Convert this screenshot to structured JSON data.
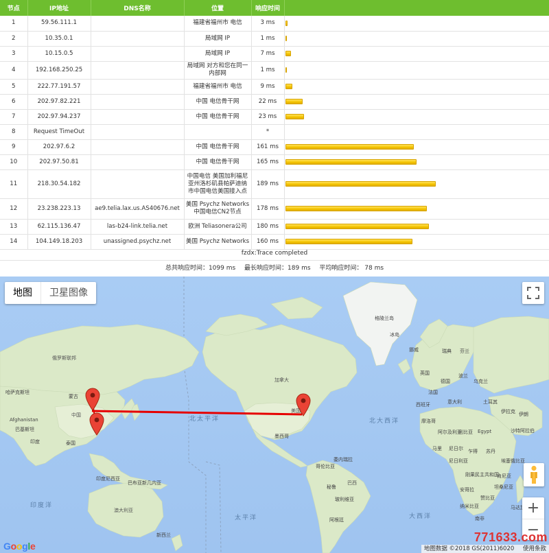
{
  "table": {
    "headers": [
      "节点",
      "IP地址",
      "DNS名称",
      "位置",
      "响应时间",
      ""
    ],
    "rows": [
      {
        "hop": "1",
        "ip": "59.56.111.1",
        "dns": "",
        "loc": "福建省福州市 电信",
        "time": "3 ms",
        "ms": 3
      },
      {
        "hop": "2",
        "ip": "10.35.0.1",
        "dns": "",
        "loc": "局域网 IP",
        "time": "1 ms",
        "ms": 1
      },
      {
        "hop": "3",
        "ip": "10.15.0.5",
        "dns": "",
        "loc": "局域网 IP",
        "time": "7 ms",
        "ms": 7
      },
      {
        "hop": "4",
        "ip": "192.168.250.25",
        "dns": "",
        "loc": "局域网 对方和您在同一内部网",
        "time": "1 ms",
        "ms": 1
      },
      {
        "hop": "5",
        "ip": "222.77.191.57",
        "dns": "",
        "loc": "福建省福州市 电信",
        "time": "9 ms",
        "ms": 9
      },
      {
        "hop": "6",
        "ip": "202.97.82.221",
        "dns": "",
        "loc": "中国 电信骨干网",
        "time": "22 ms",
        "ms": 22
      },
      {
        "hop": "7",
        "ip": "202.97.94.237",
        "dns": "",
        "loc": "中国 电信骨干网",
        "time": "23 ms",
        "ms": 23
      },
      {
        "hop": "8",
        "ip": "Request TimeOut",
        "dns": "",
        "loc": "",
        "time": "*",
        "ms": 0
      },
      {
        "hop": "9",
        "ip": "202.97.6.2",
        "dns": "",
        "loc": "中国 电信骨干网",
        "time": "161 ms",
        "ms": 161
      },
      {
        "hop": "10",
        "ip": "202.97.50.81",
        "dns": "",
        "loc": "中国 电信骨干网",
        "time": "165 ms",
        "ms": 165
      },
      {
        "hop": "11",
        "ip": "218.30.54.182",
        "dns": "",
        "loc": "中国电信 美国加利福尼亚州洛杉矶县帕萨迪纳市中国电信美国接入点",
        "time": "189 ms",
        "ms": 189
      },
      {
        "hop": "12",
        "ip": "23.238.223.13",
        "dns": "ae9.telia.lax.us.AS40676.net",
        "loc": "美国 Psychz Networks中国电信CN2节点",
        "time": "178 ms",
        "ms": 178
      },
      {
        "hop": "13",
        "ip": "62.115.136.47",
        "dns": "las-b24-link.telia.net",
        "loc": "欧洲 Teliasonera公司",
        "time": "180 ms",
        "ms": 180
      },
      {
        "hop": "14",
        "ip": "104.149.18.203",
        "dns": "unassigned.psychz.net",
        "loc": "美国 Psychz Networks",
        "time": "160 ms",
        "ms": 160
      }
    ],
    "bar_max_ms": 189
  },
  "trace": {
    "completed": "fzdx:Trace completed",
    "total": "总共响应时间：1099 ms",
    "max": "最长响应时间：189 ms",
    "avg": "平均响应时间： 78 ms"
  },
  "map": {
    "tab_map": "地图",
    "tab_satellite": "卫星图像",
    "zoom_in": "+",
    "zoom_out": "−",
    "logo_letters": [
      "G",
      "o",
      "o",
      "g",
      "l",
      "e"
    ],
    "logo_colors": [
      "#4285f4",
      "#ea4335",
      "#fbbc05",
      "#4285f4",
      "#34a853",
      "#ea4335"
    ],
    "attribution": "地图数据 ©2018 GS(2011)6020",
    "terms": "使用条款",
    "watermark": "771633.com",
    "route_color": "#e60000",
    "marker_color": "#ea4335",
    "labels": {
      "greenland": "格陵兰岛",
      "norway": "挪威",
      "sweden": "瑞典",
      "finland": "芬兰",
      "iceland": "冰岛",
      "russia": "俄罗斯联邦",
      "kazakhstan": "哈萨克斯坦",
      "mongolia": "蒙古",
      "china": "中国",
      "afghanistan": "Afghanistan",
      "pakistan": "巴基斯坦",
      "india": "印度",
      "thailand": "泰国",
      "indonesia": "印度尼西亚",
      "png": "巴布亚新几内亚",
      "australia": "澳大利亚",
      "nz": "新西兰",
      "canada": "加拿大",
      "usa": "美国",
      "mexico": "墨西哥",
      "venezuela": "委内瑞拉",
      "colombia": "哥伦比亚",
      "peru": "秘鲁",
      "brazil": "巴西",
      "bolivia": "玻利维亚",
      "argentina": "阿根廷",
      "uk": "英国",
      "germany": "德国",
      "poland": "波兰",
      "ukraine": "乌克兰",
      "france": "法国",
      "spain": "西班牙",
      "italy": "意大利",
      "turkey": "土耳其",
      "iran": "伊朗",
      "iraq": "伊拉克",
      "saudi": "沙特阿拉伯",
      "egypt": "Egypt",
      "libya": "利比亚",
      "algeria": "阿尔及利亚",
      "morocco": "摩洛哥",
      "mali": "马里",
      "niger": "尼日尔",
      "chad": "乍得",
      "sudan": "苏丹",
      "ethiopia": "埃塞俄比亚",
      "nigeria": "尼日利亚",
      "drc": "刚果民主共和国",
      "kenya": "肯尼亚",
      "tanzania": "坦桑尼亚",
      "angola": "安哥拉",
      "zambia": "赞比亚",
      "namibia": "纳米比亚",
      "southafrica": "南非",
      "madagascar": "马达加斯加",
      "north_pacific": "北太平洋",
      "north_atlantic": "北大西洋",
      "south_pacific": "太平洋",
      "south_atlantic": "大西洋",
      "indian_ocean": "印度洋"
    }
  }
}
